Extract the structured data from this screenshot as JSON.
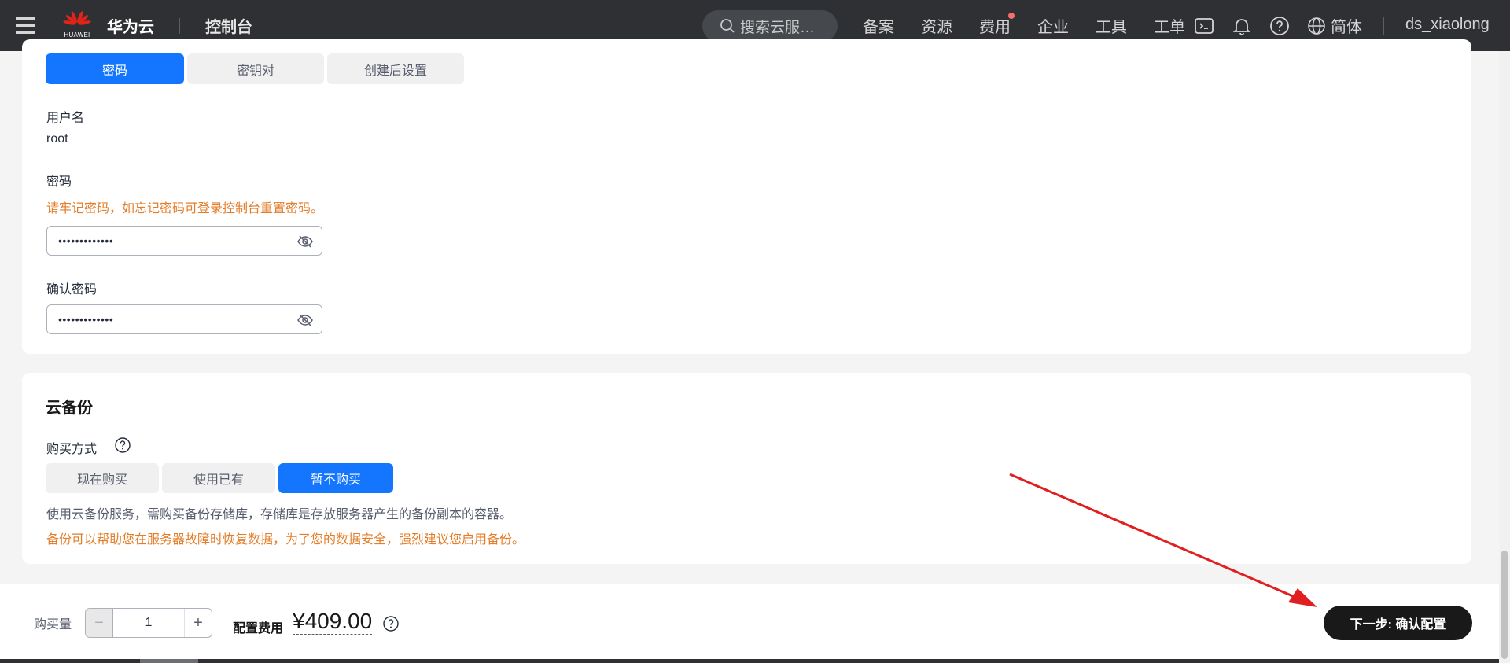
{
  "header": {
    "logo_text": "华为云",
    "logo_sub": "HUAWEI",
    "console": "控制台",
    "search_placeholder": "搜索云服…",
    "nav": [
      "备案",
      "资源",
      "费用",
      "企业",
      "工具",
      "工单"
    ],
    "language": "简体",
    "username": "ds_xiaolong"
  },
  "login": {
    "tabs": [
      "密码",
      "密钥对",
      "创建后设置"
    ],
    "username_label": "用户名",
    "username_value": "root",
    "password_label": "密码",
    "password_warning": "请牢记密码，如忘记密码可登录控制台重置密码。",
    "password_value": "•••••••••••••",
    "confirm_label": "确认密码",
    "confirm_value": "•••••••••••••"
  },
  "backup": {
    "title": "云备份",
    "purchase_label": "购买方式",
    "options": [
      "现在购买",
      "使用已有",
      "暂不购买"
    ],
    "selected": "暂不购买",
    "hint": "使用云备份服务，需购买备份存储库，存储库是存放服务器产生的备份副本的容器。",
    "warning": "备份可以帮助您在服务器故障时恢复数据，为了您的数据安全，强烈建议您启用备份。"
  },
  "footer": {
    "qty_label": "购买量",
    "qty_value": "1",
    "minus": "−",
    "plus": "+",
    "fee_label": "配置费用",
    "fee_value": "¥409.00",
    "next_button": "下一步: 确认配置"
  },
  "colors": {
    "primary": "#1476ff",
    "warning": "#e37d29",
    "nav_bg": "#2e3033",
    "annotation_arrow": "#e02020"
  }
}
